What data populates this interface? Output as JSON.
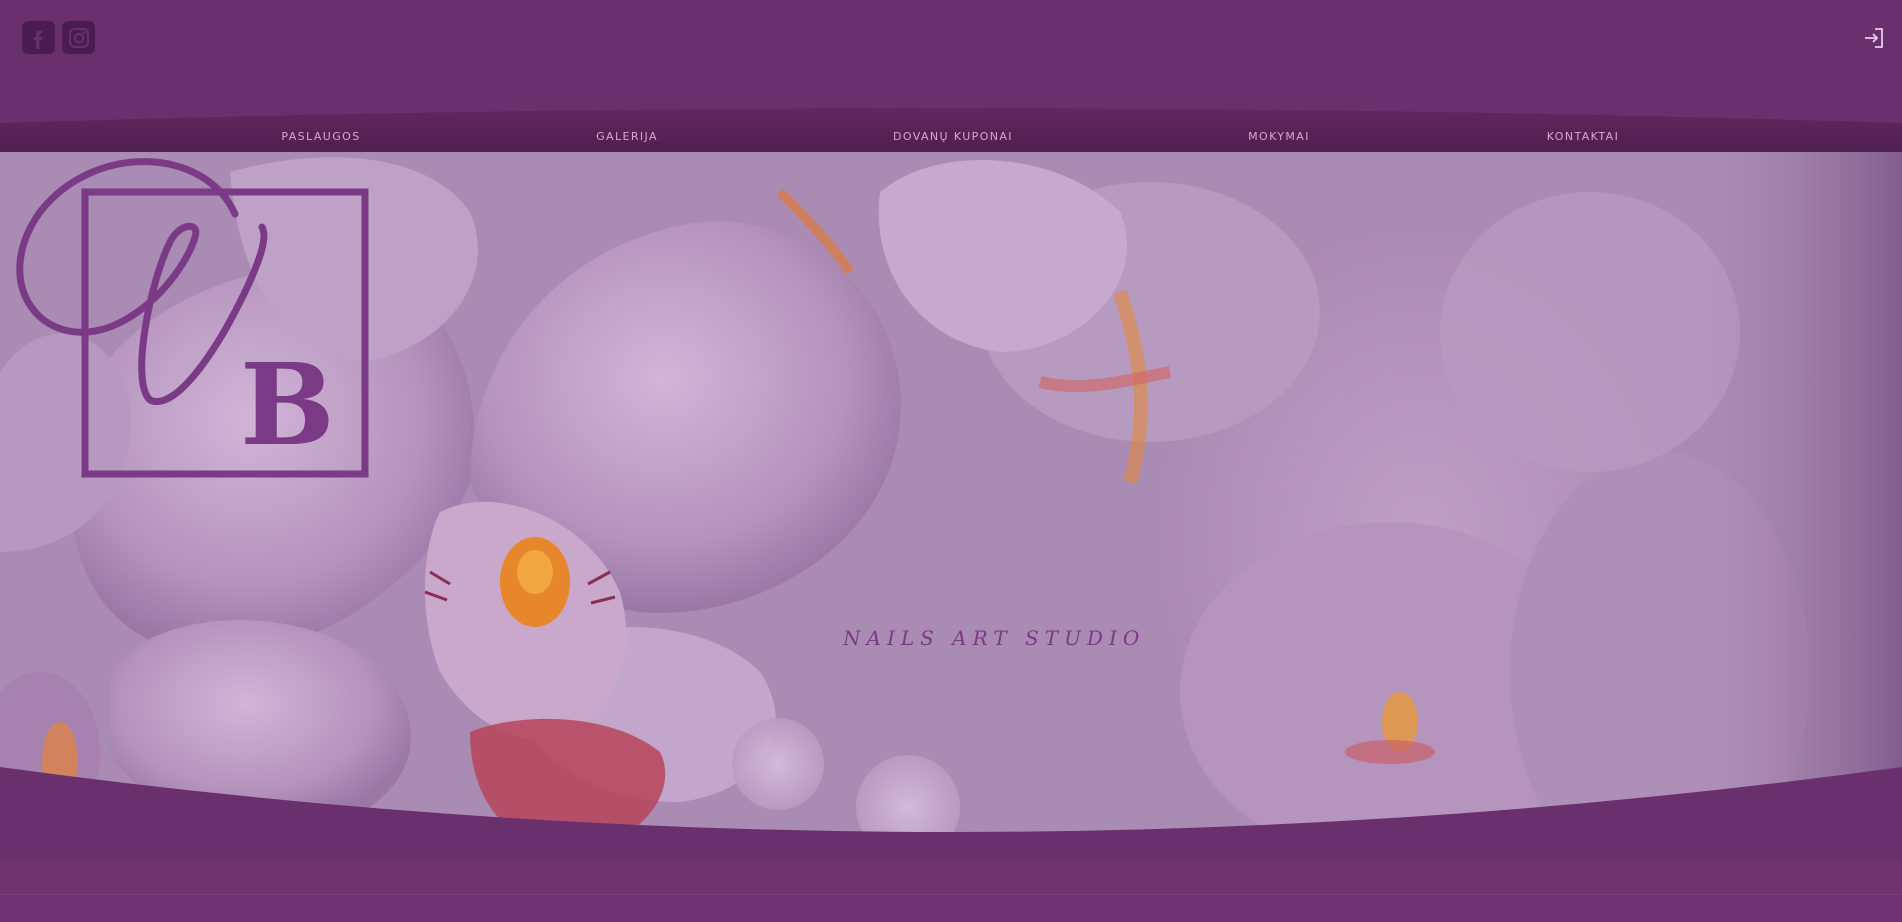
{
  "header": {
    "social": [
      {
        "name": "facebook-icon"
      },
      {
        "name": "instagram-icon"
      }
    ],
    "login_icon": "login-icon"
  },
  "nav": {
    "items": [
      {
        "label": "PASLAUGOS"
      },
      {
        "label": "GALERIJA"
      },
      {
        "label": "DOVANŲ KUPONAI"
      },
      {
        "label": "MOKYMAI"
      },
      {
        "label": "KONTAKTAI"
      }
    ]
  },
  "hero": {
    "logo_initials": "VB",
    "tagline": "NAILS ART STUDIO"
  },
  "colors": {
    "brand": "#6a306d",
    "brand_dark": "#4b1c52",
    "logo": "#7b3a86",
    "nav_text": "#d6a8cc"
  }
}
